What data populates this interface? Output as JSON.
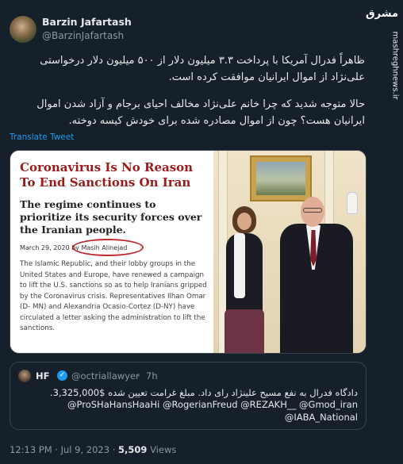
{
  "tweet": {
    "author_name": "Barzin Jafartash",
    "author_handle": "@BarzinJafartash",
    "paragraph1": "ظاهراً فدرال آمریکا با پرداخت ۳.۳ میلیون دلار از ۵۰۰ میلیون دلار درخواستی علی‌نژاد از اموال ایرانیان موافقت کرده است.",
    "paragraph2": "حالا متوجه شدید که چرا خانم علی‌نژاد مخالف احیای برجام و آزاد شدن اموال ایرانیان هست؟ چون از اموال مصادره شده برای خودش کیسه دوخته.",
    "translate_label": "Translate Tweet",
    "timestamp": "12:13 PM · Jul 9, 2023 ·",
    "views_count": "5,509",
    "views_label": "Views"
  },
  "article": {
    "title": "Coronavirus Is No Reason To End Sanctions On Iran",
    "subtitle": "The regime continues to prioritize its security forces over the Iranian people.",
    "meta": "March 29, 2020 by Masih Alinejad",
    "body": "The Islamic Republic, and their lobby groups in the United States and Europe, have renewed a campaign to lift the U.S. sanctions so as to help Iranians gripped by the Coronavirus crisis. Representatives Ilhan Omar (D- MN) and Alexandria Ocasio-Cortez (D-NY) have circulated a letter asking the administration to lift the sanctions."
  },
  "quote": {
    "name": "HF",
    "verified_icon": "✓",
    "handle": "@octriallawyer",
    "separator": "·",
    "time": "7h",
    "text": "دادگاه فدرال به نفع مسیح علینژاد رای داد. مبلغ غرامت تعیین شده  $3,325,000.",
    "mentions_line1": "@ProSHaHansHaaHi @RogerianFreud @REZAKH__ @Gmod_iran",
    "mentions_line2": "@IABA_National"
  },
  "watermark": {
    "logo_text": "مشرق",
    "site": "mashreghnews.ir"
  },
  "colors": {
    "background": "#15202b",
    "link": "#1d9bf0",
    "title_red": "#9b1b1b"
  }
}
